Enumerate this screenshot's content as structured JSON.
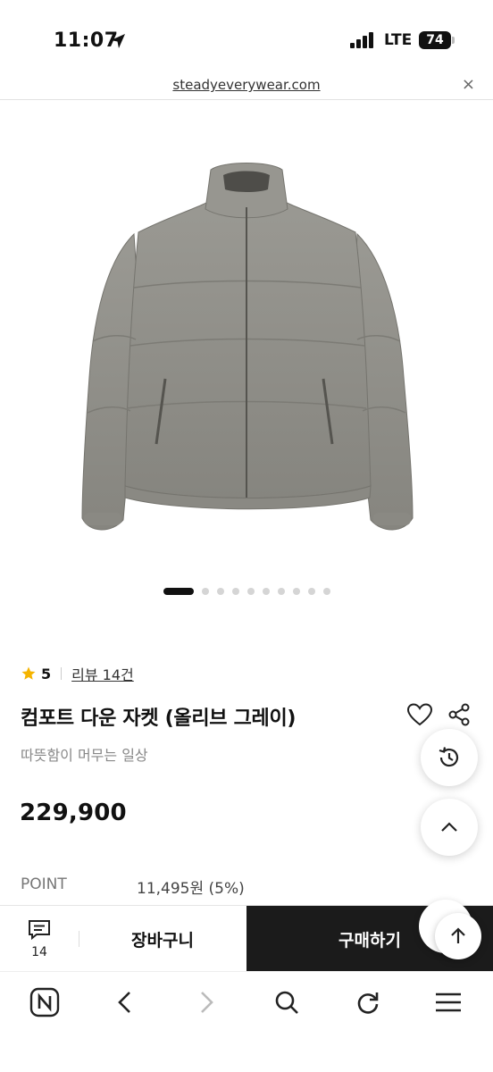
{
  "status_bar": {
    "time": "11:07",
    "network": "LTE",
    "battery": "74"
  },
  "browser": {
    "url": "steadyeverywear.com",
    "close_label": "×"
  },
  "carousel": {
    "total_dots": 10,
    "active_index": 0
  },
  "product": {
    "rating": "5",
    "review_link": "리뷰 14건",
    "title": "컴포트 다운 자켓 (올리브 그레이)",
    "subtitle": "따뜻함이 머무는 일상",
    "price": "229,900",
    "point_label": "POINT",
    "point_value": "11,495원 (5%)"
  },
  "action_bar": {
    "chat_count": "14",
    "cart_label": "장바구니",
    "buy_label": "구매하기"
  },
  "colors": {
    "accent_star": "#f5b400",
    "buy_button_bg": "#1b1b1b",
    "jacket": "#8d8c86"
  },
  "icons": [
    "location-arrow-icon",
    "signal-icon",
    "close-icon",
    "star-icon",
    "heart-icon",
    "share-icon",
    "history-icon",
    "chevron-up-icon",
    "chat-icon",
    "arrow-up-icon",
    "naver-icon",
    "back-icon",
    "forward-icon",
    "search-icon",
    "refresh-icon",
    "menu-icon"
  ]
}
